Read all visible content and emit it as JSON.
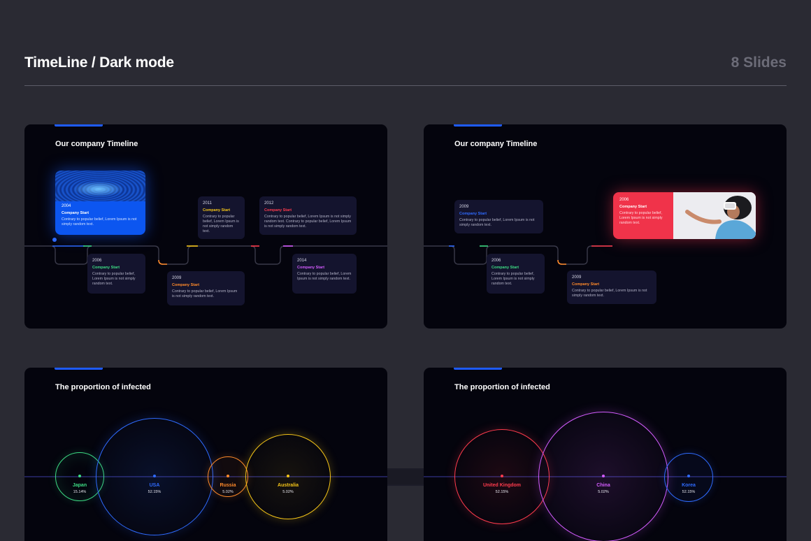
{
  "header": {
    "title": "TimeLine  / Dark mode",
    "count": "8 Slides"
  },
  "slides": {
    "timeline_a": {
      "title": "Our company Timeline",
      "cards": [
        {
          "year": "2004",
          "head": "Company Start",
          "body": "Contrary to popular belief, Lorem Ipsum is not simply random text.",
          "accent": "#ffffff"
        },
        {
          "year": "2006",
          "head": "Company Start",
          "body": "Contrary to popular belief, Lorem Ipsum is not simply random text.",
          "accent": "#3ddc84"
        },
        {
          "year": "2011",
          "head": "Company Start",
          "body": "Contrary to popular belief, Lorem Ipsum is not simply random text.",
          "accent": "#f5c518"
        },
        {
          "year": "2009",
          "head": "Company Start",
          "body": "Contrary to popular belief, Lorem Ipsum is not simply random text.",
          "accent": "#ff8a2a"
        },
        {
          "year": "2012",
          "head": "Company Start",
          "body": "Contrary to popular belief, Lorem Ipsum is not simply random text. Contrary to popular belief, Lorem Ipsum is not simply random text.",
          "accent": "#ff3b4d"
        },
        {
          "year": "2014",
          "head": "Company Start",
          "body": "Contrary to popular belief, Lorem Ipsum is not simply random text.",
          "accent": "#d45cff"
        }
      ]
    },
    "timeline_b": {
      "title": "Our company Timeline",
      "cards": [
        {
          "year": "2009",
          "head": "Company Start",
          "body": "Contrary to popular belief, Lorem Ipsum is not simply random text.",
          "accent": "#2f6bff"
        },
        {
          "year": "2006",
          "head": "Company Start",
          "body": "Contrary to popular belief, Lorem Ipsum is not simply random text.",
          "accent": "#3ddc84"
        },
        {
          "year": "2009",
          "head": "Company Start",
          "body": "Contrary to popular belief, Lorem Ipsum is not simply random text.",
          "accent": "#ff8a2a"
        },
        {
          "year": "2006",
          "head": "Company Start",
          "body": "Contrary to popular belief, Lorem Ipsum is not simply random text.",
          "accent": "#ffffff"
        }
      ]
    },
    "bubbles_a": {
      "title": "The proportion of infected",
      "items": [
        {
          "name": "Japan",
          "value": "15.14%",
          "color": "#3ddc84"
        },
        {
          "name": "USA",
          "value": "52.15%",
          "color": "#2f6bff"
        },
        {
          "name": "Russia",
          "value": "5.02%",
          "color": "#ff8a2a"
        },
        {
          "name": "Australia",
          "value": "5.02%",
          "color": "#f5c518"
        }
      ]
    },
    "bubbles_b": {
      "title": "The proportion of infected",
      "items": [
        {
          "name": "United Kingdom",
          "value": "52.15%",
          "color": "#ff3b4d"
        },
        {
          "name": "China",
          "value": "5.02%",
          "color": "#d45cff"
        },
        {
          "name": "Korea",
          "value": "52.15%",
          "color": "#2f6bff"
        }
      ]
    }
  }
}
